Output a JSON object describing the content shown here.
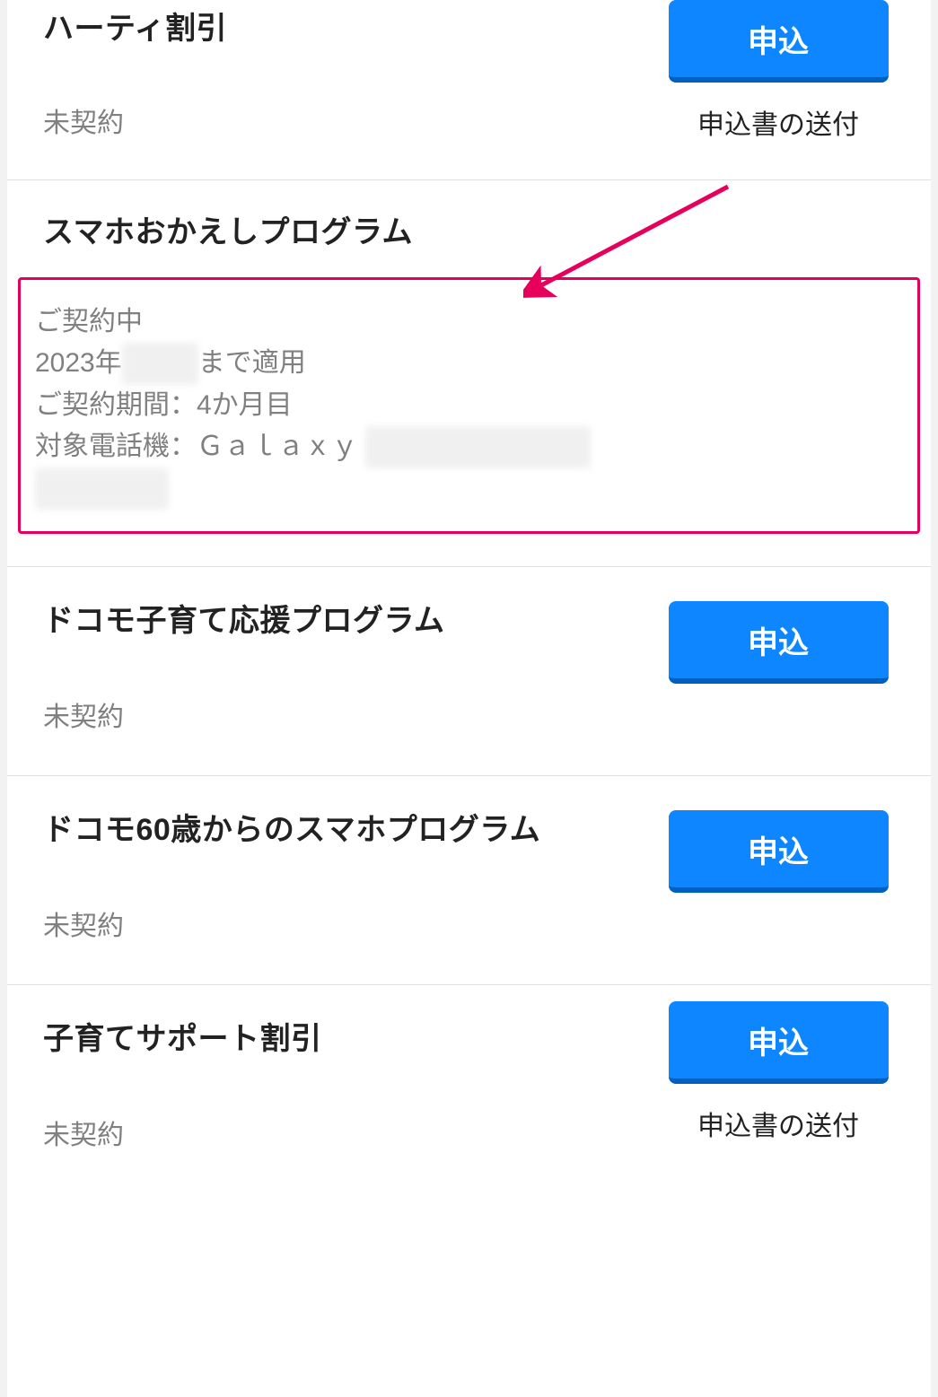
{
  "items": [
    {
      "title": "ハーティ割引",
      "status": "未契約",
      "button": "申込",
      "sub_link": "申込書の送付"
    },
    {
      "title": "スマホおかえしプログラム",
      "detail": {
        "line1": "ご契約中",
        "line2_pre": "2023年",
        "line2_blur": "████",
        "line2_post": "まで適用",
        "line3": "ご契約期間：4か月目",
        "line4_pre": "対象電話機：Ｇａｌａｘｙ",
        "line4_blur": "███ ██ ██████",
        "line5_blur": "███████"
      }
    },
    {
      "title": "ドコモ子育て応援プログラム",
      "status": "未契約",
      "button": "申込"
    },
    {
      "title": "ドコモ60歳からのスマホプログラム",
      "status": "未契約",
      "button": "申込"
    },
    {
      "title": "子育てサポート割引",
      "status": "未契約",
      "button": "申込",
      "sub_link": "申込書の送付"
    }
  ]
}
